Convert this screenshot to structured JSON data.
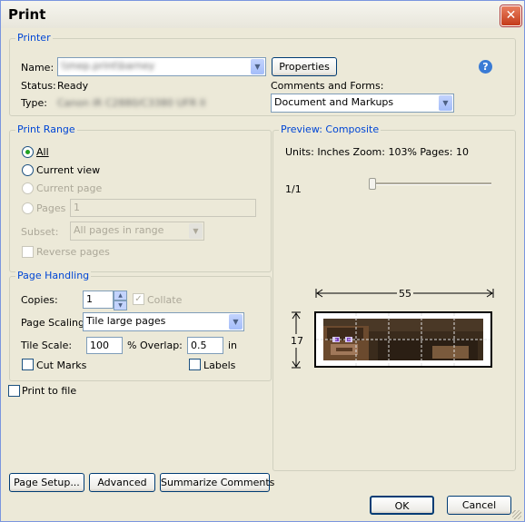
{
  "window": {
    "title": "Print"
  },
  "printer": {
    "legend": "Printer",
    "name_label": "Name:",
    "name_value": "\\\\mep.print\\barney",
    "properties_button": "Properties",
    "status_label": "Status:",
    "status_value": "Ready",
    "type_label": "Type:",
    "type_value": "Canon iR C2880/C3380 UFR II",
    "comments_label": "Comments and Forms:",
    "comments_value": "Document and Markups"
  },
  "print_range": {
    "legend": "Print Range",
    "all": "All",
    "current_view": "Current view",
    "current_page": "Current page",
    "pages": "Pages",
    "pages_value": "1",
    "subset_label": "Subset:",
    "subset_value": "All pages in range",
    "reverse_pages": "Reverse pages"
  },
  "page_handling": {
    "legend": "Page Handling",
    "copies_label": "Copies:",
    "copies_value": "1",
    "collate": "Collate",
    "page_scaling_label": "Page Scaling:",
    "page_scaling_value": "Tile large pages",
    "tile_scale_label": "Tile Scale:",
    "tile_scale_value": "100",
    "overlap_label": "% Overlap:",
    "overlap_value": "0.5",
    "overlap_unit": "in",
    "cut_marks": "Cut Marks",
    "labels": "Labels"
  },
  "print_to_file": "Print to file",
  "preview": {
    "legend": "Preview: Composite",
    "info": "Units: Inches Zoom: 103% Pages: 10",
    "page_counter": "1/1",
    "width_dim": "55",
    "height_dim": "17"
  },
  "buttons": {
    "page_setup": "Page Setup...",
    "advanced": "Advanced",
    "summarize": "Summarize Comments",
    "ok": "OK",
    "cancel": "Cancel"
  },
  "colors": {
    "legend": "#0046d5",
    "dialog_bg": "#ece9d8",
    "help": "#3a7bd5"
  }
}
